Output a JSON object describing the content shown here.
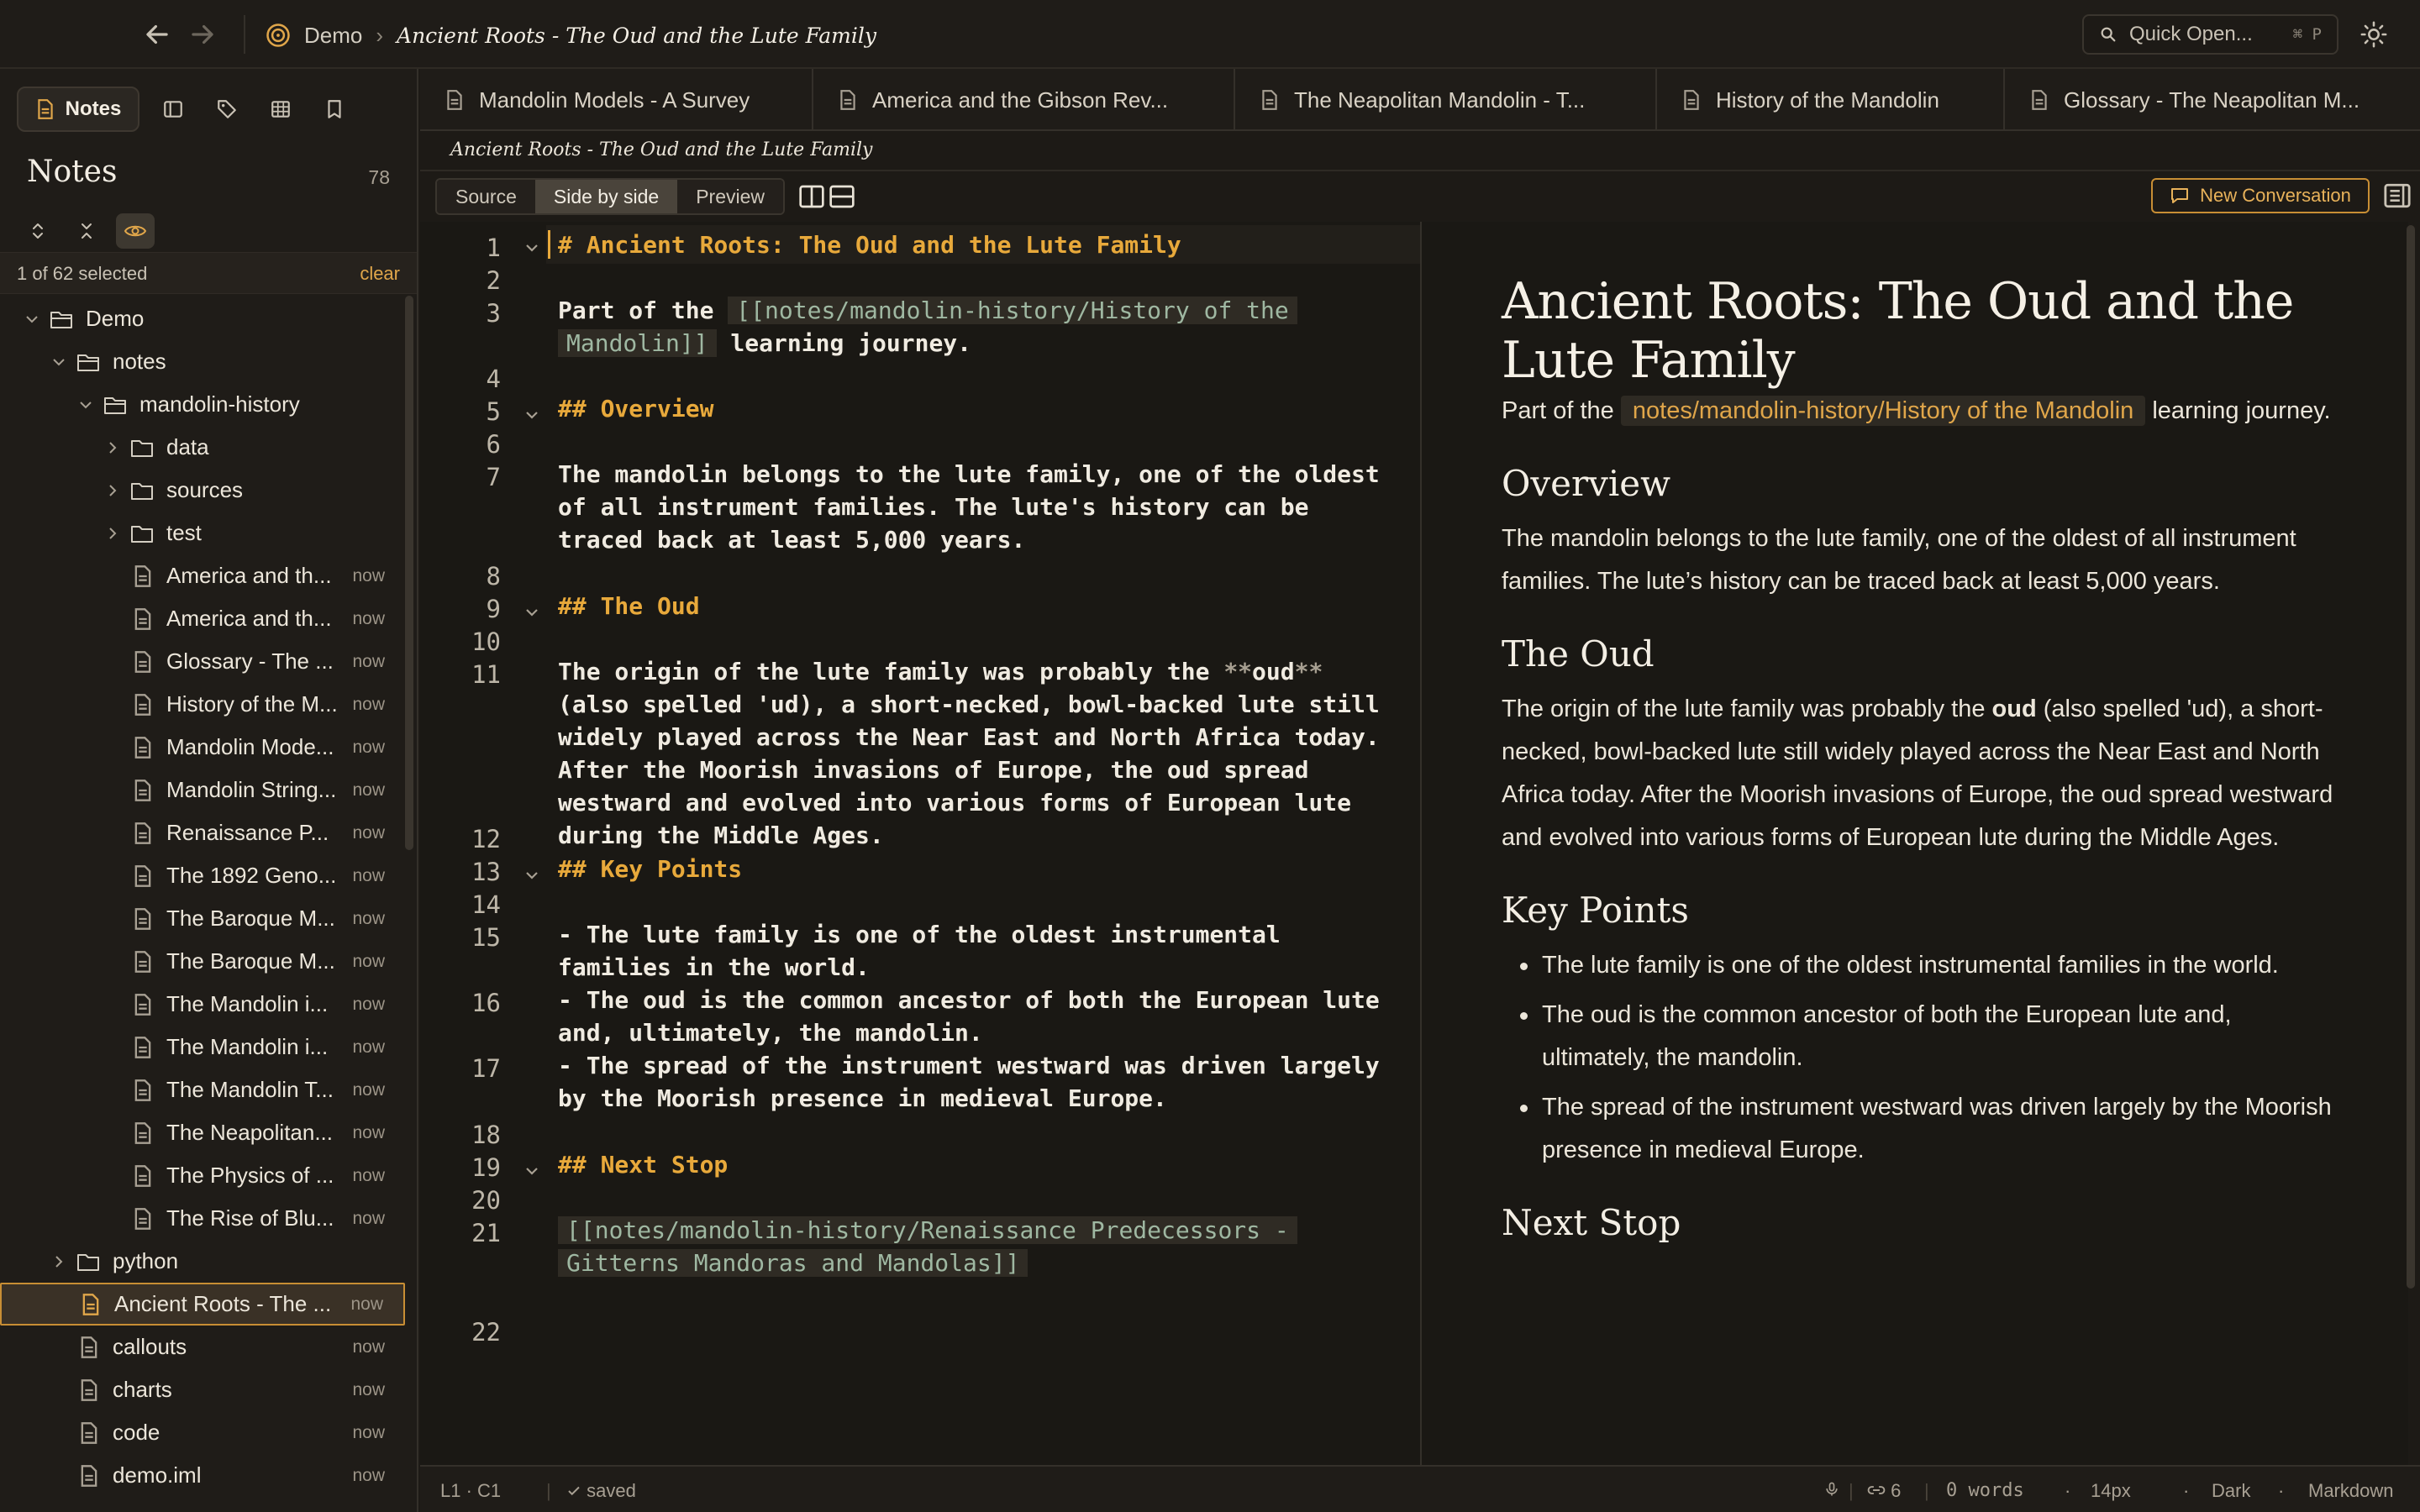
{
  "topbar": {
    "breadcrumb_root": "Demo",
    "breadcrumb_sep": "›",
    "breadcrumb_current": "Ancient Roots - The Oud and the Lute Family",
    "quick_open_placeholder": "Quick Open...",
    "quick_open_shortcut": "⌘ P"
  },
  "sidebar": {
    "notes_tab_label": "Notes",
    "title": "Notes",
    "count": "78",
    "selection_text": "1 of 62 selected",
    "clear_label": "clear",
    "tree": [
      {
        "label": "Demo",
        "type": "folder-open",
        "depth": 0,
        "chev": "down"
      },
      {
        "label": "notes",
        "type": "folder-open",
        "depth": 1,
        "chev": "down"
      },
      {
        "label": "mandolin-history",
        "type": "folder-open",
        "depth": 2,
        "chev": "down"
      },
      {
        "label": "data",
        "type": "folder",
        "depth": 3,
        "chev": "right"
      },
      {
        "label": "sources",
        "type": "folder",
        "depth": 3,
        "chev": "right"
      },
      {
        "label": "test",
        "type": "folder",
        "depth": 3,
        "chev": "right"
      },
      {
        "label": "America and th...",
        "type": "file",
        "depth": 3,
        "time": "now"
      },
      {
        "label": "America and th...",
        "type": "file",
        "depth": 3,
        "time": "now"
      },
      {
        "label": "Glossary - The ...",
        "type": "file",
        "depth": 3,
        "time": "now"
      },
      {
        "label": "History of the M...",
        "type": "file",
        "depth": 3,
        "time": "now"
      },
      {
        "label": "Mandolin Mode...",
        "type": "file",
        "depth": 3,
        "time": "now"
      },
      {
        "label": "Mandolin String...",
        "type": "file",
        "depth": 3,
        "time": "now"
      },
      {
        "label": "Renaissance P...",
        "type": "file",
        "depth": 3,
        "time": "now"
      },
      {
        "label": "The 1892 Geno...",
        "type": "file",
        "depth": 3,
        "time": "now"
      },
      {
        "label": "The Baroque M...",
        "type": "file",
        "depth": 3,
        "time": "now"
      },
      {
        "label": "The Baroque M...",
        "type": "file",
        "depth": 3,
        "time": "now"
      },
      {
        "label": "The Mandolin i...",
        "type": "file",
        "depth": 3,
        "time": "now"
      },
      {
        "label": "The Mandolin i...",
        "type": "file",
        "depth": 3,
        "time": "now"
      },
      {
        "label": "The Mandolin T...",
        "type": "file",
        "depth": 3,
        "time": "now"
      },
      {
        "label": "The Neapolitan...",
        "type": "file",
        "depth": 3,
        "time": "now"
      },
      {
        "label": "The Physics of ...",
        "type": "file",
        "depth": 3,
        "time": "now"
      },
      {
        "label": "The Rise of Blu...",
        "type": "file",
        "depth": 3,
        "time": "now"
      },
      {
        "label": "python",
        "type": "folder",
        "depth": 1,
        "chev": "right"
      },
      {
        "label": "Ancient Roots - The ...",
        "type": "file",
        "depth": 1,
        "time": "now",
        "selected": true
      },
      {
        "label": "callouts",
        "type": "file",
        "depth": 1,
        "time": "now"
      },
      {
        "label": "charts",
        "type": "file",
        "depth": 1,
        "time": "now"
      },
      {
        "label": "code",
        "type": "file",
        "depth": 1,
        "time": "now"
      },
      {
        "label": "demo.iml",
        "type": "file",
        "depth": 1,
        "time": "now"
      }
    ]
  },
  "tabs": [
    {
      "label": "Mandolin Models - A Survey"
    },
    {
      "label": "America and the Gibson Rev..."
    },
    {
      "label": "The Neapolitan Mandolin - T..."
    },
    {
      "label": "History of the Mandolin"
    },
    {
      "label": "Glossary - The Neapolitan M..."
    }
  ],
  "doc_title": "Ancient Roots - The Oud and the Lute Family",
  "modes": {
    "source": "Source",
    "side": "Side by side",
    "preview": "Preview"
  },
  "new_conversation_label": "New Conversation",
  "editor": {
    "line_numbers": [
      "1",
      "2",
      "3",
      "4",
      "5",
      "6",
      "7",
      "8",
      "9",
      "10",
      "11",
      "12",
      "13",
      "14",
      "15",
      "16",
      "17",
      "18",
      "19",
      "20",
      "21",
      "22"
    ],
    "l1": "# Ancient Roots: The Oud and the Lute Family",
    "l3a": "Part of the ",
    "l3link1": "[[notes/mandolin-history/History of the",
    "l3link2": "Mandolin]]",
    "l3b": " learning journey.",
    "l5": "## Overview",
    "l7": "The mandolin belongs to the lute family, one of the oldest\nof all instrument families. The lute's history can be\ntraced back at least 5,000 years.",
    "l9": "## The Oud",
    "l11a": "The origin of the lute family was probably the ",
    "l11star": "**",
    "l11b": "oud",
    "l11rest": "(also spelled 'ud), a short-necked, bowl-backed lute still\nwidely played across the Near East and North Africa today.\nAfter the Moorish invasions of Europe, the oud spread\nwestward and evolved into various forms of European lute\nduring the Middle Ages.",
    "l13": "## Key Points",
    "l15": "- The lute family is one of the oldest instrumental\nfamilies in the world.",
    "l16": "- The oud is the common ancestor of both the European lute\nand, ultimately, the mandolin.",
    "l17": "- The spread of the instrument westward was driven largely\nby the Moorish presence in medieval Europe.",
    "l19": "## Next Stop",
    "l21a": "[[notes/mandolin-history/Renaissance Predecessors -",
    "l21b": "Gitterns Mandoras and Mandolas]]"
  },
  "preview": {
    "h1": "Ancient Roots: The Oud and the Lute Family",
    "intro_a": "Part of the",
    "intro_link": "notes/mandolin-history/History of the Mandolin",
    "intro_b": "learning journey.",
    "h2_overview": "Overview",
    "overview_p": "The mandolin belongs to the lute family, one of the oldest of all instrument families. The lute’s history can be traced back at least 5,000 years.",
    "h2_oud": "The Oud",
    "oud_p_a": "The origin of the lute family was probably the ",
    "oud_p_bold": "oud",
    "oud_p_b": " (also spelled 'ud), a short-necked, bowl-backed lute still widely played across the Near East and North Africa today. After the Moorish invasions of Europe, the oud spread westward and evolved into various forms of European lute during the Middle Ages.",
    "h2_key": "Key Points",
    "key_points": [
      "The lute family is one of the oldest instrumental families in the world.",
      "The oud is the common ancestor of both the European lute and, ultimately, the mandolin.",
      "The spread of the instrument westward was driven largely by the Moorish presence in medieval Europe."
    ],
    "h2_next": "Next Stop"
  },
  "status": {
    "position": "L1 · C1",
    "saved": "saved",
    "links": "6",
    "words": "0 words",
    "font_size": "14px",
    "theme": "Dark",
    "language": "Markdown",
    "dot": "·"
  },
  "colors": {
    "accent": "#e8a93b",
    "bg": "#1a1814",
    "sidebar_bg": "#1f1c18"
  }
}
